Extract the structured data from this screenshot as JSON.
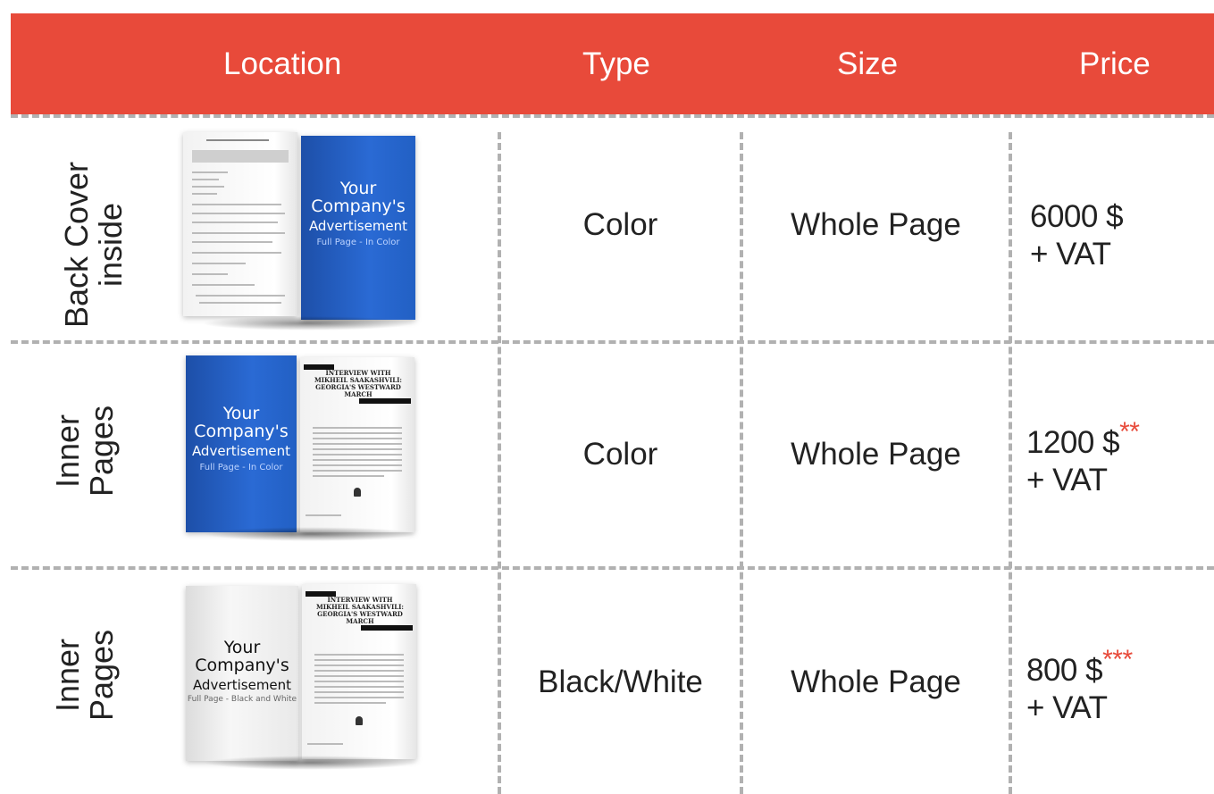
{
  "header": {
    "location": "Location",
    "type": "Type",
    "size": "Size",
    "price": "Price"
  },
  "rows": [
    {
      "location_line1": "Back Cover",
      "location_line2": "inside",
      "type": "Color",
      "size": "Whole Page",
      "price_line1": "6000 $",
      "price_marker": "",
      "price_line2": "+ VAT",
      "ad": {
        "your": "Your",
        "company": "Company's",
        "advertisement": "Advertisement",
        "sub": "Full Page - In Color"
      }
    },
    {
      "location_line1": "Inner",
      "location_line2": "Pages",
      "type": "Color",
      "size": "Whole Page",
      "price_line1": "1200 $",
      "price_marker": "**",
      "price_line2": "+ VAT",
      "ad": {
        "your": "Your",
        "company": "Company's",
        "advertisement": "Advertisement",
        "sub": "Full Page - In Color"
      },
      "headline": "INTERVIEW WITH MIKHEIL SAAKASHVILI: GEORGIA'S WESTWARD MARCH"
    },
    {
      "location_line1": "Inner",
      "location_line2": "Pages",
      "type": "Black/White",
      "size": "Whole Page",
      "price_line1": "800 $",
      "price_marker": "***",
      "price_line2": "+ VAT",
      "ad": {
        "your": "Your",
        "company": "Company's",
        "advertisement": "Advertisement",
        "sub": "Full Page - Black and White"
      },
      "headline": "INTERVIEW WITH MIKHEIL SAAKASHVILI: GEORGIA'S WESTWARD MARCH"
    }
  ],
  "colors": {
    "header_bg": "#e84a3a",
    "accent_star": "#e84a3a",
    "divider": "#b1b1b1",
    "ad_blue": "#2a6ad4"
  }
}
